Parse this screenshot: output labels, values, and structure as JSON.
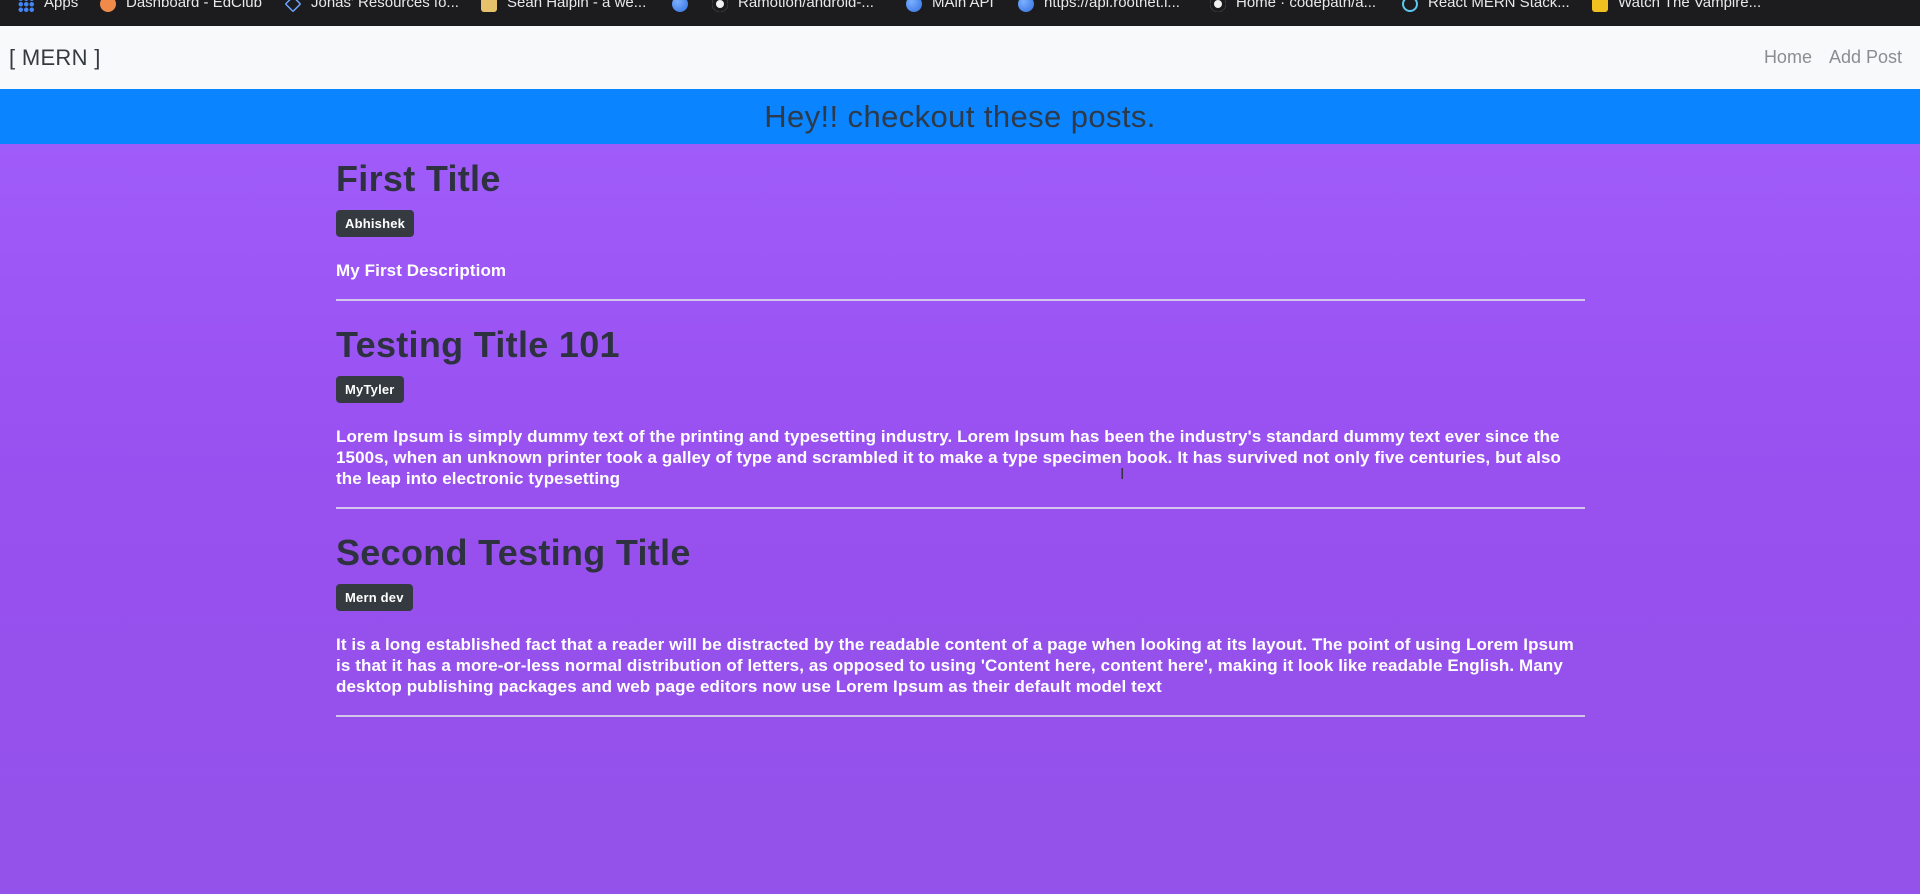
{
  "bookmarks": [
    {
      "label": "Apps",
      "icon": "apps-grid-icon"
    },
    {
      "label": "Dashboard - EdClub",
      "icon": "edclub-icon"
    },
    {
      "label": "Jonas' Resources fo...",
      "icon": "jonas-icon"
    },
    {
      "label": "Sean Halpin - a we...",
      "icon": "sean-icon"
    },
    {
      "label": "",
      "icon": "globe-icon"
    },
    {
      "label": "Ramotion/android-...",
      "icon": "github-icon"
    },
    {
      "label": "MAin API",
      "icon": "globe-icon"
    },
    {
      "label": "https://api.roothet.i...",
      "icon": "globe-icon"
    },
    {
      "label": "Home · codepath/a...",
      "icon": "github-icon"
    },
    {
      "label": "React MERN Stack...",
      "icon": "react-icon"
    },
    {
      "label": "Watch The Vampire...",
      "icon": "vampire-icon"
    }
  ],
  "navbar": {
    "brand": "[ MERN ]",
    "links": [
      "Home",
      "Add Post"
    ]
  },
  "banner": {
    "text": "Hey!! checkout these posts."
  },
  "posts": [
    {
      "title": "First Title",
      "author": "Abhishek",
      "description": "My First Descriptiom"
    },
    {
      "title": "Testing Title 101",
      "author": "MyTyler",
      "description": "Lorem Ipsum is simply dummy text of the printing and typesetting industry. Lorem Ipsum has been the industry's standard dummy text ever since the 1500s, when an unknown printer took a galley of type and scrambled it to make a type specimen book. It has survived not only five centuries, but also the leap into electronic typesetting"
    },
    {
      "title": "Second Testing Title",
      "author": "Mern dev",
      "description": "It is a long established fact that a reader will be distracted by the readable content of a page when looking at its layout. The point of using Lorem Ipsum is that it has a more-or-less normal distribution of letters, as opposed to using 'Content here, content here', making it look like readable English. Many desktop publishing packages and web page editors now use Lorem Ipsum as their default model text"
    }
  ],
  "colors": {
    "banner": "#0a84ff",
    "page_background": "#9b57ef",
    "navbar": "#f8f9fa",
    "badge": "#343a40"
  }
}
